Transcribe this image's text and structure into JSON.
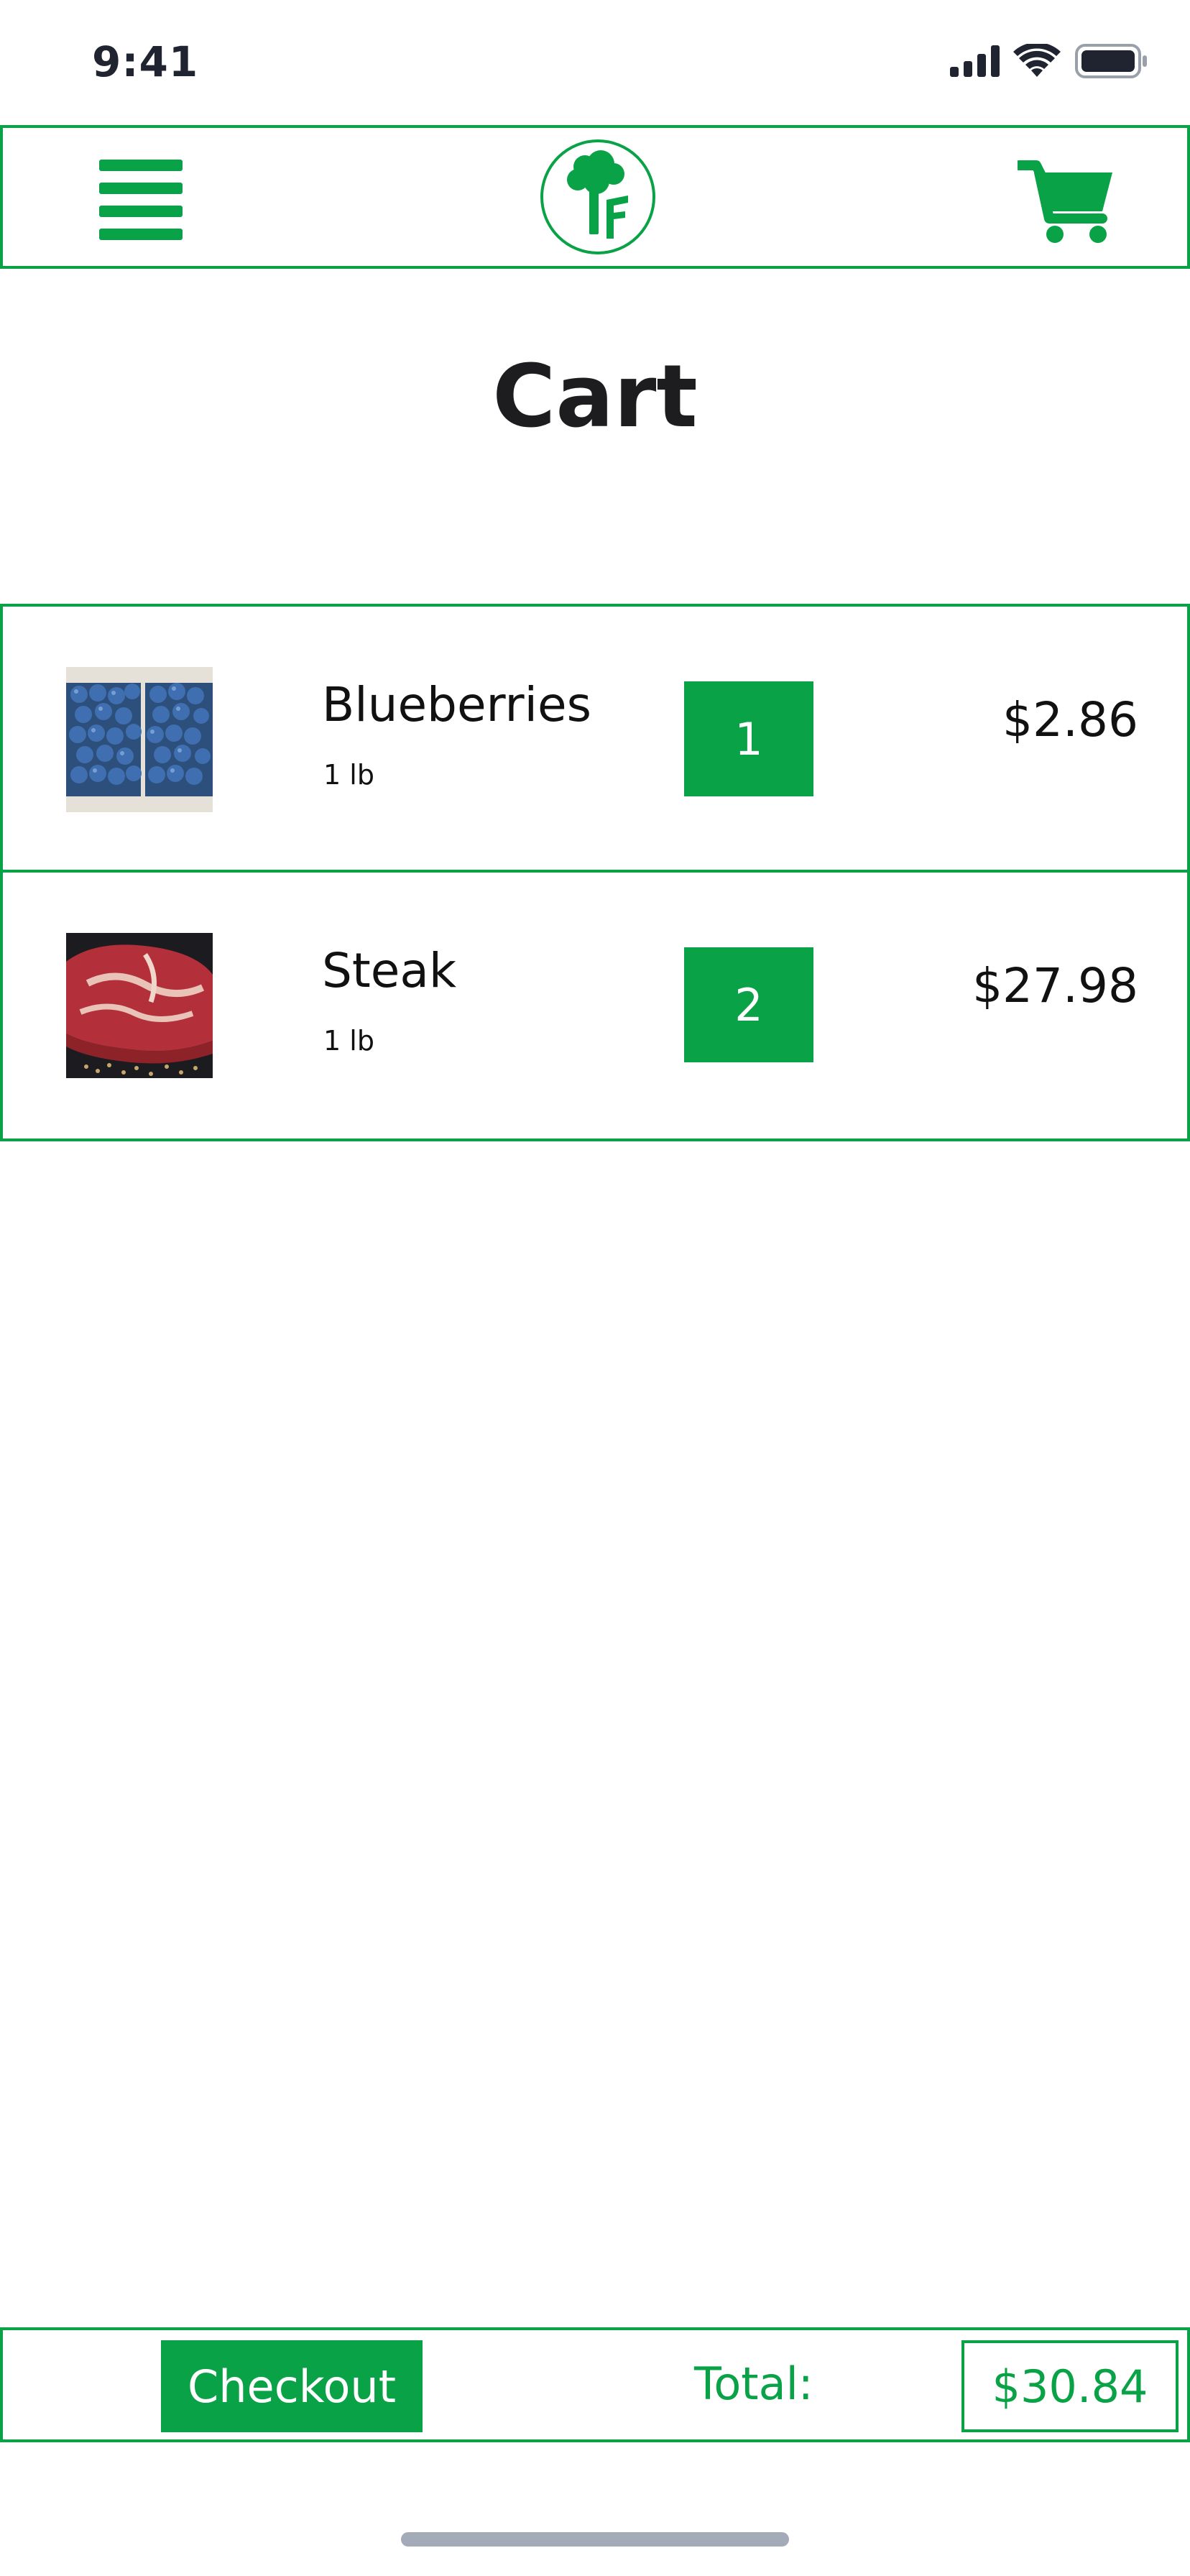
{
  "status_bar": {
    "time": "9:41"
  },
  "header": {
    "menu_icon": "hamburger-menu-icon",
    "logo_icon": "tree-f-logo",
    "cart_icon": "shopping-cart-icon"
  },
  "page": {
    "title": "Cart"
  },
  "cart": {
    "items": [
      {
        "image": "blueberries-photo",
        "name": "Blueberries",
        "unit": "1 lb",
        "quantity": "1",
        "price": "$2.86"
      },
      {
        "image": "steak-photo",
        "name": "Steak",
        "unit": "1 lb",
        "quantity": "2",
        "price": "$27.98"
      }
    ]
  },
  "footer": {
    "checkout_label": "Checkout",
    "total_label": "Total:",
    "total_value": "$30.84"
  },
  "colors": {
    "brand_green": "#0aa246",
    "text_dark": "#111111"
  }
}
